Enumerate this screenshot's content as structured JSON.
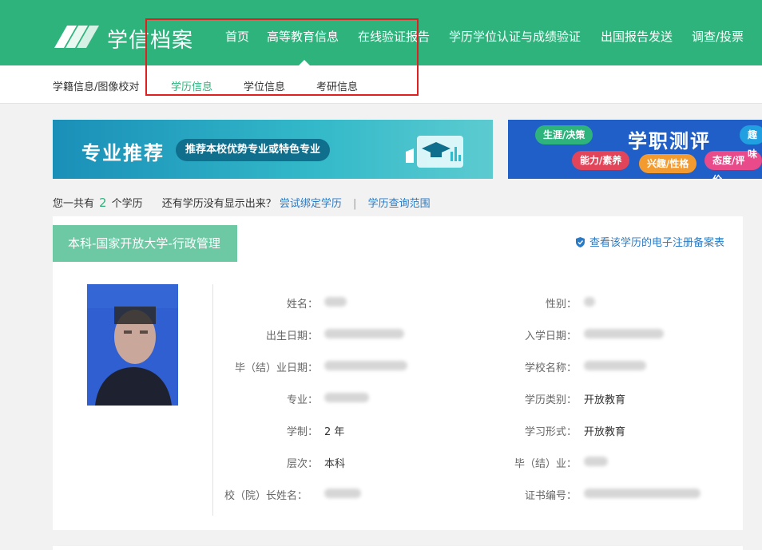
{
  "header": {
    "brand": "学信档案",
    "nav": [
      "首页",
      "高等教育信息",
      "在线验证报告",
      "学历学位认证与成绩验证",
      "出国报告发送",
      "调查/投票"
    ]
  },
  "subnav": [
    "学籍信息/图像校对",
    "学历信息",
    "学位信息",
    "考研信息"
  ],
  "banners": {
    "major": {
      "title": "专业推荐",
      "pill": "推荐本校优势专业或特色专业"
    },
    "career": {
      "title": "学职测评",
      "chips": [
        "生涯/决策",
        "能力/素养",
        "兴趣/性格",
        "态度/评价",
        "趣味"
      ]
    }
  },
  "summary": {
    "prefix": "您一共有",
    "count": "2",
    "suffix": "个学历",
    "question": "还有学历没有显示出来？",
    "bind_link": "尝试绑定学历",
    "scope_link": "学历查询范围"
  },
  "record": {
    "tag": "本科-国家开放大学-行政管理",
    "reg_link": "查看该学历的电子注册备案表",
    "left_fields": [
      {
        "label": "姓名：",
        "value": ""
      },
      {
        "label": "出生日期：",
        "value": ""
      },
      {
        "label": "毕（结）业日期：",
        "value": ""
      },
      {
        "label": "专业：",
        "value": ""
      },
      {
        "label": "学制：",
        "value": "2 年"
      },
      {
        "label": "层次：",
        "value": "本科"
      },
      {
        "label": "校（院）长姓名：",
        "value": ""
      }
    ],
    "right_fields": [
      {
        "label": "性别：",
        "value": ""
      },
      {
        "label": "入学日期：",
        "value": ""
      },
      {
        "label": "学校名称：",
        "value": ""
      },
      {
        "label": "学历类别：",
        "value": "开放教育"
      },
      {
        "label": "学习形式：",
        "value": "开放教育"
      },
      {
        "label": "毕（结）业：",
        "value": ""
      },
      {
        "label": "证书编号：",
        "value": ""
      }
    ]
  },
  "colors": {
    "brand_green": "#2eb37c",
    "link_blue": "#2a7bc4",
    "highlight_red": "#e02020"
  }
}
